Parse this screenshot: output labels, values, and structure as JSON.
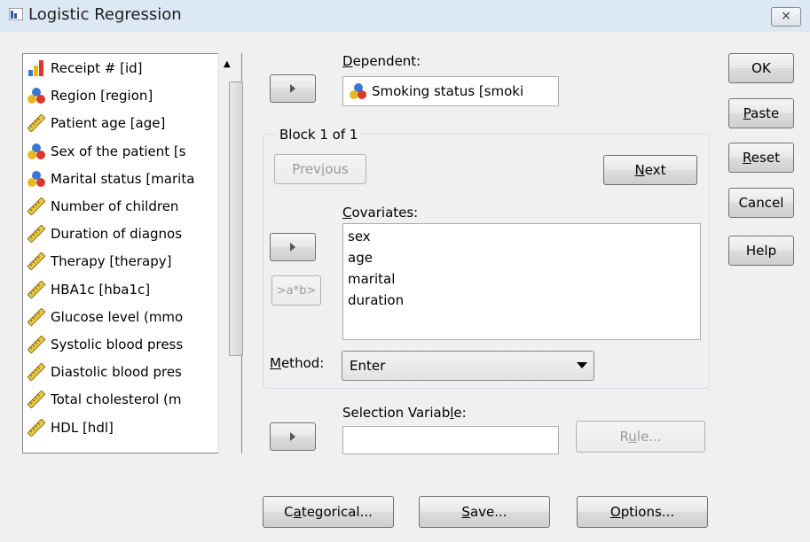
{
  "window": {
    "title": "Logistic Regression",
    "close_glyph": "⨯"
  },
  "variables": [
    {
      "label": "Receipt # [id]",
      "icon": "scale-icon"
    },
    {
      "label": "Region [region]",
      "icon": "nominal-icon"
    },
    {
      "label": "Patient age [age]",
      "icon": "ruler-icon"
    },
    {
      "label": "Sex of the patient [s",
      "icon": "nominal-icon"
    },
    {
      "label": "Marital status [marita",
      "icon": "nominal-icon"
    },
    {
      "label": "Number of children",
      "icon": "ruler-icon"
    },
    {
      "label": "Duration of diagnos",
      "icon": "ruler-icon"
    },
    {
      "label": "Therapy [therapy]",
      "icon": "ruler-icon"
    },
    {
      "label": "HBA1c [hba1c]",
      "icon": "ruler-icon"
    },
    {
      "label": "Glucose level (mmo",
      "icon": "ruler-icon"
    },
    {
      "label": "Systolic blood press",
      "icon": "ruler-icon"
    },
    {
      "label": "Diastolic blood pres",
      "icon": "ruler-icon"
    },
    {
      "label": "Total cholesterol (m",
      "icon": "ruler-icon"
    },
    {
      "label": "HDL [hdl]",
      "icon": "ruler-icon"
    }
  ],
  "dependent": {
    "label": "Dependent:",
    "accesskey": "D",
    "value": "Smoking status [smoki"
  },
  "block": {
    "label": "Block 1 of 1",
    "previous": "Previous",
    "next": "Next"
  },
  "covariates": {
    "label": "Covariates:",
    "accesskey": "C",
    "items": [
      "sex",
      "age",
      "marital",
      "duration"
    ],
    "interaction": ">a*b>"
  },
  "method": {
    "label": "Method:",
    "value": "Enter"
  },
  "selection": {
    "label": "Selection Variable:",
    "value": "",
    "rule": "Rule..."
  },
  "side_buttons": {
    "ok": "OK",
    "paste": "Paste",
    "reset": "Reset",
    "cancel": "Cancel",
    "help": "Help"
  },
  "bottom_buttons": {
    "categorical": "Categorical...",
    "save": "Save...",
    "options": "Options..."
  },
  "colors": {
    "titlebar": "#dde8f5",
    "dialog": "#f0f0f0"
  }
}
